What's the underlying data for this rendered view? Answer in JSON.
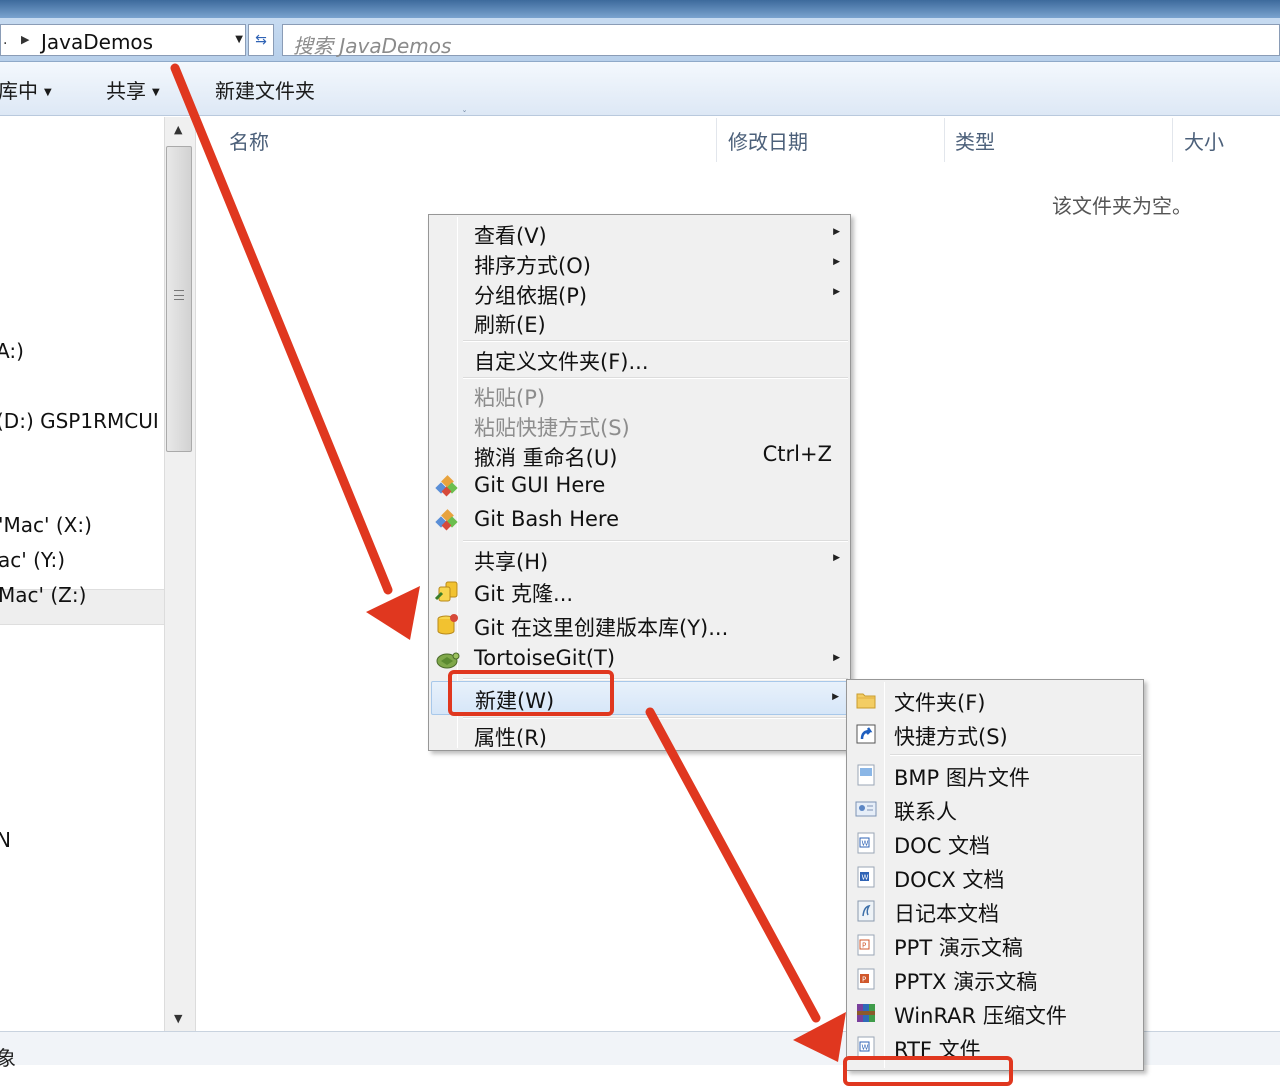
{
  "window": {
    "breadcrumb_prefix": ".",
    "breadcrumb": "JavaDemos",
    "search_placeholder": "搜索 JavaDemos"
  },
  "toolbar": {
    "items": [
      {
        "label": "库中",
        "has_dropdown": true
      },
      {
        "label": "共享",
        "has_dropdown": true
      },
      {
        "label": "新建文件夹",
        "has_dropdown": false
      }
    ]
  },
  "nav": {
    "items": [
      {
        "label": "A:)"
      },
      {
        "label": "(D:) GSP1RMCUI"
      },
      {
        "label": "'Mac' (X:)"
      },
      {
        "label": "ac' (Y:)"
      },
      {
        "label": "Mac' (Z:)"
      },
      {
        "label": "N"
      }
    ]
  },
  "columns": [
    {
      "label": "名称"
    },
    {
      "label": "修改日期"
    },
    {
      "label": "类型"
    },
    {
      "label": "大小"
    }
  ],
  "empty_message": "该文件夹为空。",
  "status_bar": {
    "text": "象"
  },
  "context_menu": {
    "items": [
      {
        "label": "查看(V)",
        "submenu": true
      },
      {
        "label": "排序方式(O)",
        "submenu": true
      },
      {
        "label": "分组依据(P)",
        "submenu": true
      },
      {
        "label": "刷新(E)"
      },
      {
        "label": "自定义文件夹(F)..."
      },
      {
        "label": "粘贴(P)",
        "disabled": true
      },
      {
        "label": "粘贴快捷方式(S)",
        "disabled": true
      },
      {
        "label": "撤消 重命名(U)",
        "shortcut": "Ctrl+Z"
      },
      {
        "label": "Git GUI Here",
        "icon": "git-gui-icon"
      },
      {
        "label": "Git Bash Here",
        "icon": "git-bash-icon"
      },
      {
        "label": "共享(H)",
        "submenu": true
      },
      {
        "label": "Git 克隆...",
        "icon": "git-clone-icon"
      },
      {
        "label": "Git 在这里创建版本库(Y)...",
        "icon": "git-create-repo-icon"
      },
      {
        "label": "TortoiseGit(T)",
        "submenu": true,
        "icon": "tortoisegit-icon"
      },
      {
        "label": "新建(W)",
        "submenu": true,
        "highlighted": true
      },
      {
        "label": "属性(R)"
      }
    ]
  },
  "new_submenu": {
    "items": [
      {
        "label": "文件夹(F)",
        "icon": "folder-icon"
      },
      {
        "label": "快捷方式(S)",
        "icon": "shortcut-icon"
      },
      {
        "label": "BMP 图片文件",
        "icon": "bmp-file-icon"
      },
      {
        "label": "联系人",
        "icon": "contact-icon"
      },
      {
        "label": "DOC 文档",
        "icon": "doc-file-icon"
      },
      {
        "label": "DOCX 文档",
        "icon": "docx-file-icon"
      },
      {
        "label": "日记本文档",
        "icon": "journal-file-icon"
      },
      {
        "label": "PPT 演示文稿",
        "icon": "ppt-file-icon"
      },
      {
        "label": "PPTX 演示文稿",
        "icon": "pptx-file-icon"
      },
      {
        "label": "WinRAR 压缩文件",
        "icon": "winrar-icon"
      },
      {
        "label": "RTF 文件",
        "icon": "rtf-file-icon"
      }
    ]
  },
  "colors": {
    "annotation_red": "#e0371f",
    "menu_background": "#f0f0f0",
    "menu_hover": "#d6e6f8"
  }
}
